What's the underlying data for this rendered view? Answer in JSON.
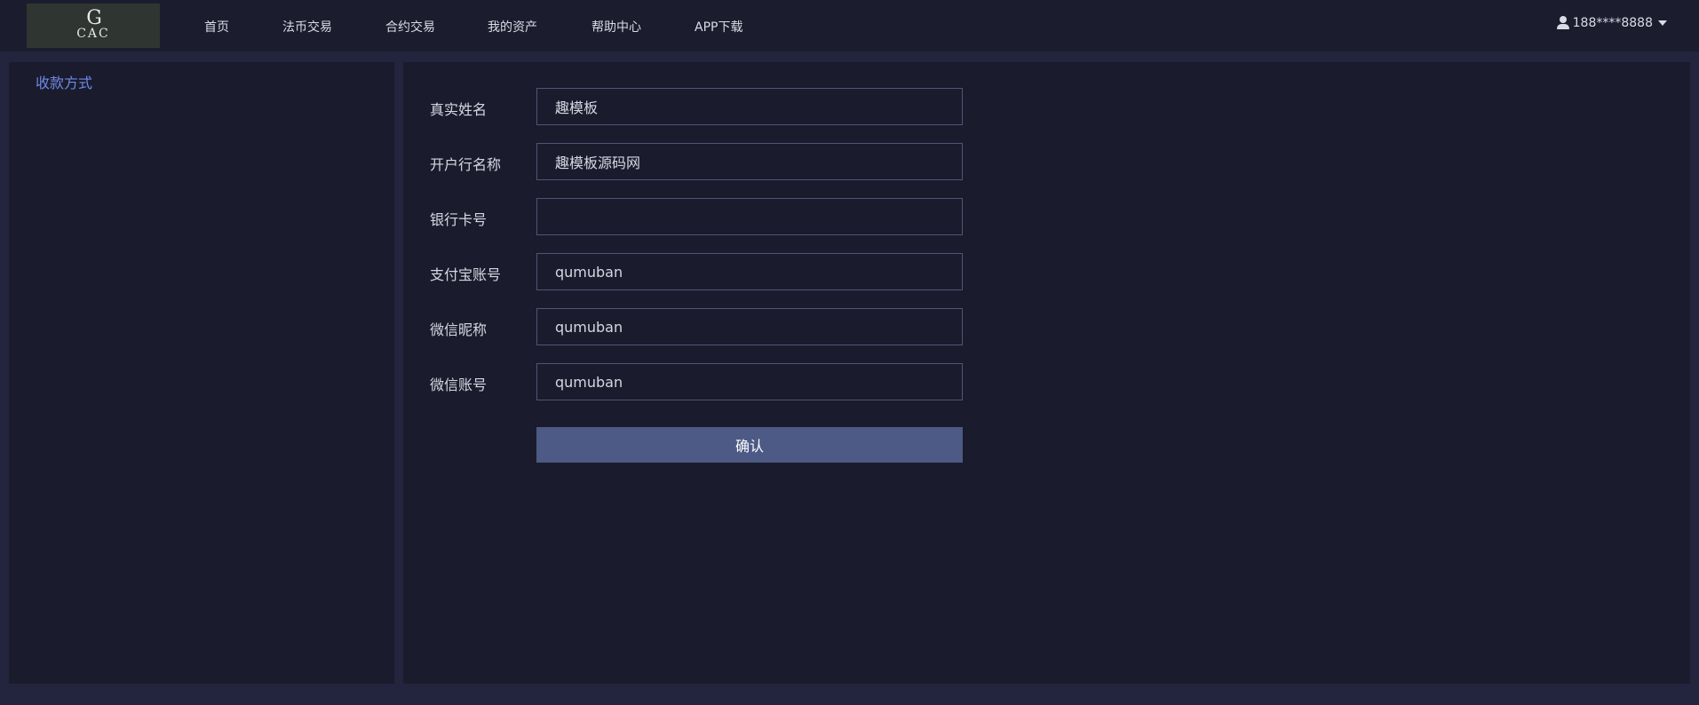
{
  "header": {
    "logo": {
      "mark": "G",
      "text": "CAC"
    },
    "nav": [
      "首页",
      "法币交易",
      "合约交易",
      "我的资产",
      "帮助中心",
      "APP下载"
    ],
    "user": {
      "name": "188****8888",
      "icon": "user-icon"
    }
  },
  "sidebar": {
    "items": [
      {
        "label": "收款方式",
        "active": true
      }
    ]
  },
  "form": {
    "fields": [
      {
        "label": "真实姓名",
        "value": "趣模板"
      },
      {
        "label": "开户行名称",
        "value": "趣模板源码网"
      },
      {
        "label": "银行卡号",
        "value": ""
      },
      {
        "label": "支付宝账号",
        "value": "qumuban"
      },
      {
        "label": "微信昵称",
        "value": "qumuban"
      },
      {
        "label": "微信账号",
        "value": "qumuban"
      }
    ],
    "confirm_label": "确认"
  },
  "colors": {
    "background": "#23243d",
    "panel": "#1a1b2c",
    "accent": "#6f8ae8",
    "button": "#4c5a85"
  }
}
